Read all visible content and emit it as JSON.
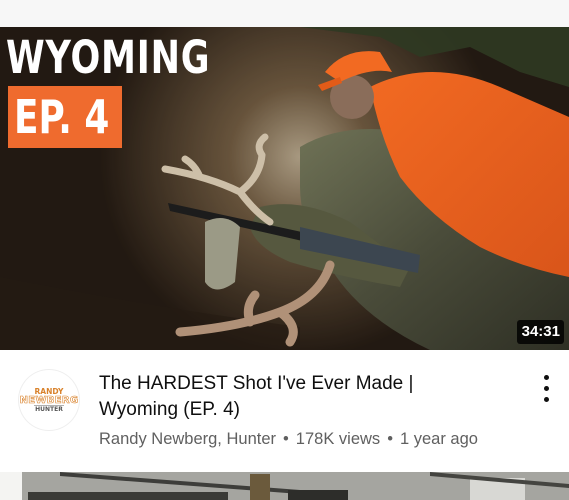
{
  "video": {
    "thumbnail": {
      "title_text": "WYOMING",
      "episode_badge": "EP. 4",
      "duration": "34:31",
      "accent_color": "#ef6b2e"
    },
    "channel_avatar": {
      "logo_text_line1": "RANDY",
      "logo_text_line2": "NEWBERG",
      "logo_text_line3": "HUNTER"
    },
    "title_line1": "The HARDEST Shot I've Ever Made |",
    "title_line2": "Wyoming (EP. 4)",
    "channel_name": "Randy Newberg, Hunter",
    "views": "178K views",
    "age": "1 year ago",
    "separator": "•",
    "more_icon": "vertical-ellipsis-icon"
  }
}
